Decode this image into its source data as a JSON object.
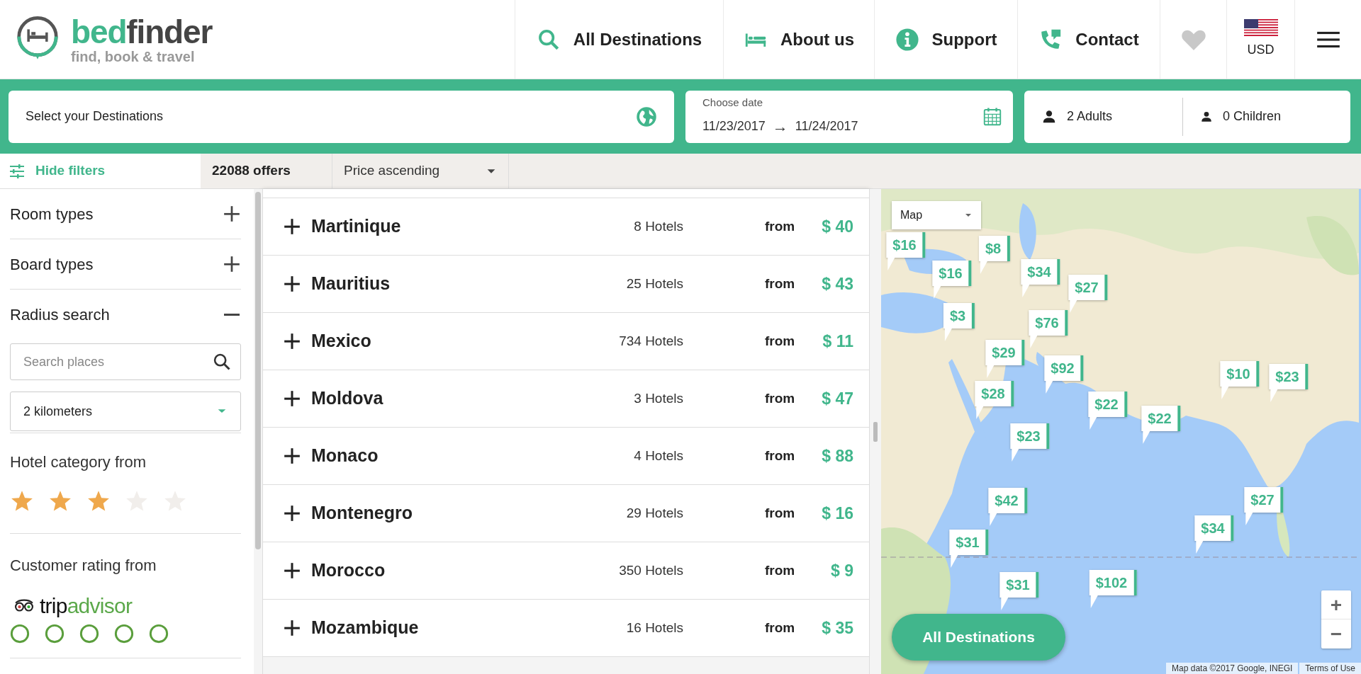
{
  "logo": {
    "brand_accent": "bed",
    "brand_rest": "finder",
    "tagline": "find, book & travel"
  },
  "nav": [
    {
      "kind": "search",
      "label": "All Destinations"
    },
    {
      "kind": "bed",
      "label": "About us"
    },
    {
      "kind": "info",
      "label": "Support"
    },
    {
      "kind": "phone",
      "label": "Contact"
    }
  ],
  "currency": "USD",
  "search": {
    "destination_placeholder": "Select your Destinations",
    "date_label": "Choose date",
    "date_from": "11/23/2017",
    "date_arrow": "→",
    "date_to": "11/24/2017",
    "adults": "2 Adults",
    "children": "0 Children"
  },
  "toolbar": {
    "filters_toggle": "Hide filters",
    "offers": "22088 offers",
    "sort": "Price ascending"
  },
  "filters": [
    {
      "label": "Room types",
      "expanded": false
    },
    {
      "label": "Board types",
      "expanded": false
    },
    {
      "label": "Radius search",
      "expanded": true
    }
  ],
  "radius": {
    "placeholder": "Search places",
    "distance": "2 kilometers"
  },
  "hotel_category": {
    "label": "Hotel category from",
    "stars": 3
  },
  "customer_rating": {
    "label": "Customer rating from",
    "provider_accent": "trip",
    "provider_rest": "advisor",
    "stars": 0
  },
  "destinations": [
    {
      "name": "Martinique",
      "hotels": "8 Hotels",
      "from": "from",
      "price": "$ 40"
    },
    {
      "name": "Mauritius",
      "hotels": "25 Hotels",
      "from": "from",
      "price": "$ 43"
    },
    {
      "name": "Mexico",
      "hotels": "734 Hotels",
      "from": "from",
      "price": "$ 11"
    },
    {
      "name": "Moldova",
      "hotels": "3 Hotels",
      "from": "from",
      "price": "$ 47"
    },
    {
      "name": "Monaco",
      "hotels": "4 Hotels",
      "from": "from",
      "price": "$ 88"
    },
    {
      "name": "Montenegro",
      "hotels": "29 Hotels",
      "from": "from",
      "price": "$ 16"
    },
    {
      "name": "Morocco",
      "hotels": "350 Hotels",
      "from": "from",
      "price": "$ 9"
    },
    {
      "name": "Mozambique",
      "hotels": "16 Hotels",
      "from": "from",
      "price": "$ 35"
    }
  ],
  "map": {
    "type_select": "Map",
    "pins": [
      "$8",
      "$16",
      "$16",
      "$34",
      "$27",
      "$3",
      "$29",
      "$28",
      "$76",
      "$92",
      "$22",
      "$22",
      "$23",
      "$10",
      "$23",
      "$42",
      "$27",
      "$34",
      "$31",
      "$31",
      "$102"
    ],
    "zoom_in": "+",
    "zoom_out": "−",
    "all_button": "All Destinations",
    "attribution": "Map data ©2017 Google, INEGI",
    "terms": "Terms of Use"
  }
}
